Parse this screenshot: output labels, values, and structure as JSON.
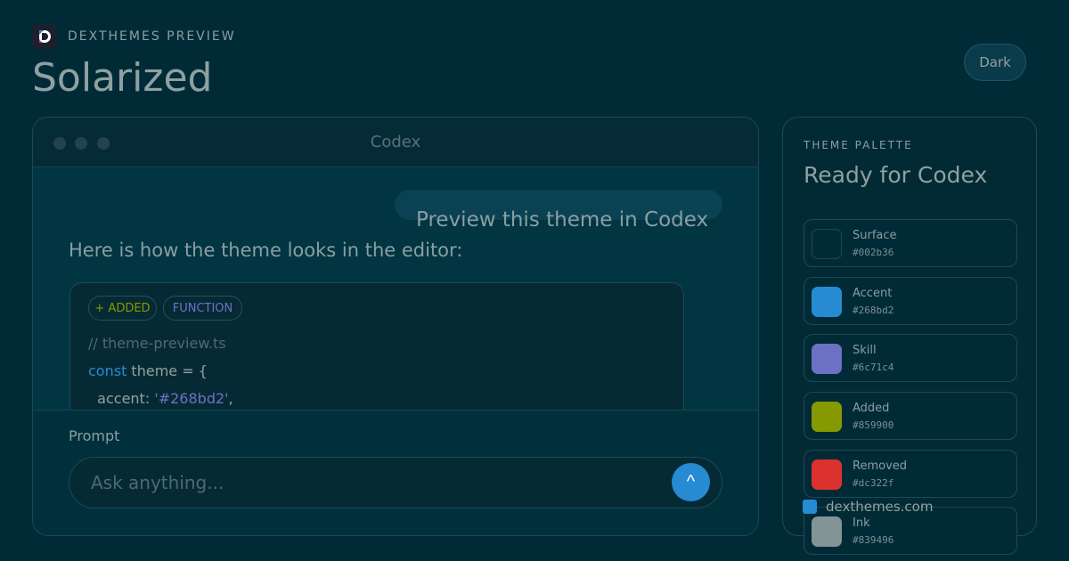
{
  "header": {
    "brand": "DEXTHEMES PREVIEW",
    "theme_name": "Solarized",
    "mode": "Dark"
  },
  "window": {
    "title": "Codex",
    "user_message": "Preview this theme in Codex",
    "assistant_message": "Here is how the theme looks in the editor:",
    "tags": {
      "added": "+ ADDED",
      "function": "FUNCTION"
    },
    "code": {
      "comment": "// theme-preview.ts",
      "line2_keyword": "const",
      "line2_rest": " theme = {",
      "line3_key": "  accent: ",
      "line3_value": "'#268bd2'",
      "line3_tail": ","
    },
    "prompt": {
      "label": "Prompt",
      "placeholder": "Ask anything...",
      "send_icon": "^"
    }
  },
  "palette": {
    "eyebrow": "THEME PALETTE",
    "title": "Ready for Codex",
    "swatches": [
      {
        "name": "Surface",
        "hex": "#002b36",
        "color": "#002b36"
      },
      {
        "name": "Accent",
        "hex": "#268bd2",
        "color": "#268bd2"
      },
      {
        "name": "Skill",
        "hex": "#6c71c4",
        "color": "#6c71c4"
      },
      {
        "name": "Added",
        "hex": "#859900",
        "color": "#859900"
      },
      {
        "name": "Removed",
        "hex": "#dc322f",
        "color": "#dc322f"
      },
      {
        "name": "Ink",
        "hex": "#839496",
        "color": "#839496"
      }
    ]
  },
  "footer": {
    "link": "dexthemes.com",
    "icon": "square-icon",
    "icon_color": "#268bd2"
  }
}
